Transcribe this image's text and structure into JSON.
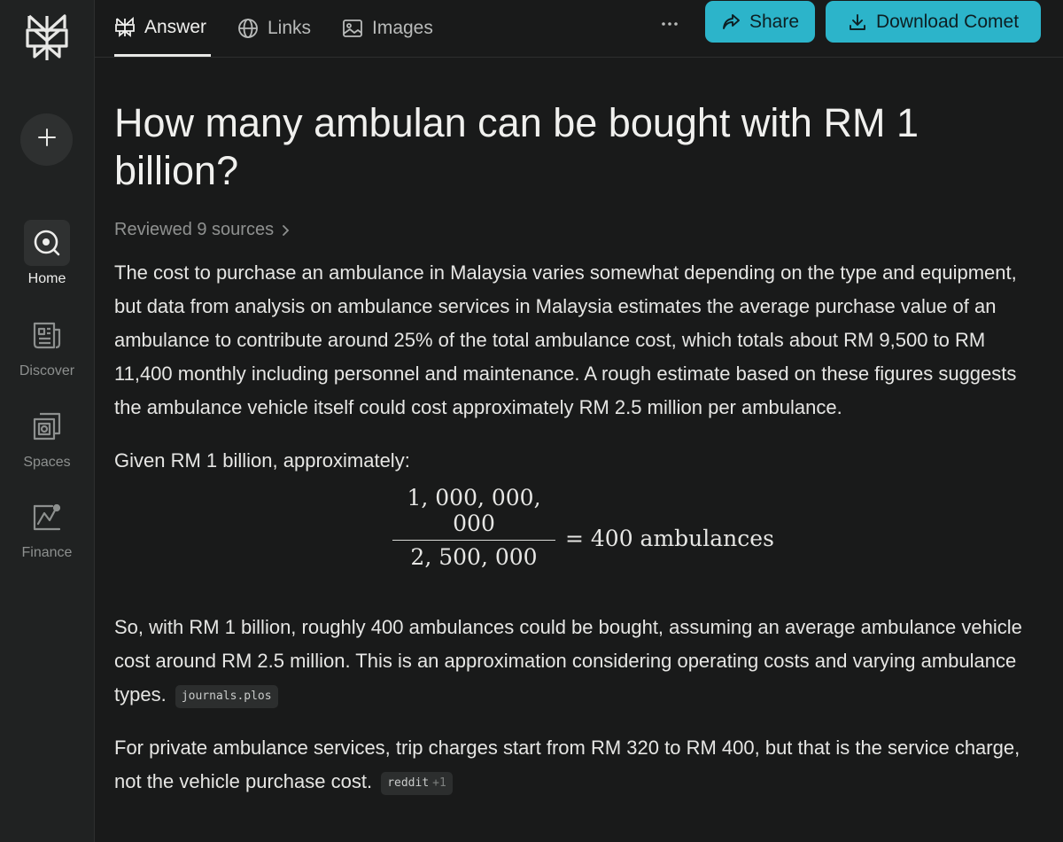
{
  "sidebar": {
    "logo_icon": "perplexity-logo-icon",
    "new_thread_icon": "plus-icon",
    "items": [
      {
        "label": "Home",
        "icon": "home-search-icon",
        "active": true
      },
      {
        "label": "Discover",
        "icon": "newspaper-icon",
        "active": false
      },
      {
        "label": "Spaces",
        "icon": "spaces-icon",
        "active": false
      },
      {
        "label": "Finance",
        "icon": "chart-icon",
        "active": false
      }
    ]
  },
  "tabs": [
    {
      "label": "Answer",
      "icon": "perplexity-answer-icon",
      "active": true
    },
    {
      "label": "Links",
      "icon": "globe-icon",
      "active": false
    },
    {
      "label": "Images",
      "icon": "image-icon",
      "active": false
    }
  ],
  "toolbar": {
    "more_icon": "ellipsis-icon",
    "share_label": "Share",
    "share_icon": "share-arrow-icon",
    "download_label": "Download Comet",
    "download_icon": "download-icon",
    "accent_color": "#2cb4ca"
  },
  "answer": {
    "title": "How many ambulan can be bought with RM 1 billion?",
    "sources_label": "Reviewed 9 sources",
    "paragraph1": "The cost to purchase an ambulance in Malaysia varies somewhat depending on the type and equipment, but data from analysis on ambulance services in Malaysia estimates the average purchase value of an ambulance to contribute around 25% of the total ambulance cost, which totals about RM 9,500 to RM 11,400 monthly including personnel and maintenance. A rough estimate based on these figures suggests the ambulance vehicle itself could cost approximately RM 2.5 million per ambulance.",
    "paragraph2": "Given RM 1 billion, approximately:",
    "formula": {
      "numerator": "1, 000, 000, 000",
      "denominator": "2, 500, 000",
      "result": "= 400 ambulances"
    },
    "paragraph3": "So, with RM 1 billion, roughly 400 ambulances could be bought, assuming an average ambulance vehicle cost around RM 2.5 million. This is an approximation considering operating costs and varying ambulance types.",
    "citation1": "journals.plos",
    "paragraph4": "For private ambulance services, trip charges start from RM 320 to RM 400, but that is the service charge, not the vehicle purchase cost.",
    "citation2": "reddit",
    "citation2_extra": "+1"
  }
}
